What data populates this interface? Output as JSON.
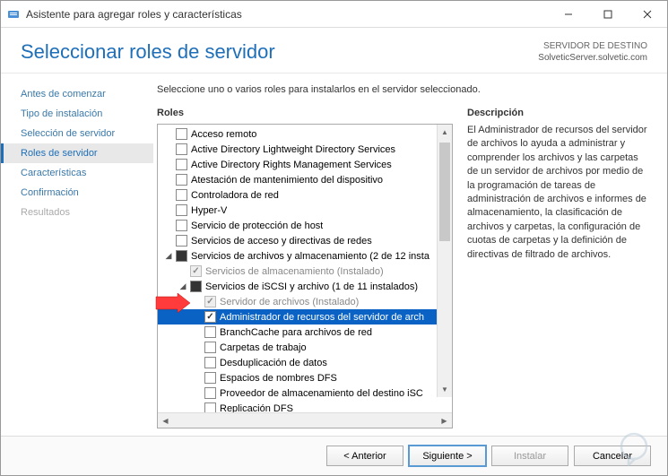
{
  "window": {
    "title": "Asistente para agregar roles y características"
  },
  "header": {
    "page_title": "Seleccionar roles de servidor",
    "dest_label": "SERVIDOR DE DESTINO",
    "dest_value": "SolveticServer.solvetic.com"
  },
  "sidebar": {
    "items": [
      {
        "label": "Antes de comenzar",
        "state": "normal"
      },
      {
        "label": "Tipo de instalación",
        "state": "normal"
      },
      {
        "label": "Selección de servidor",
        "state": "normal"
      },
      {
        "label": "Roles de servidor",
        "state": "active"
      },
      {
        "label": "Características",
        "state": "normal"
      },
      {
        "label": "Confirmación",
        "state": "normal"
      },
      {
        "label": "Resultados",
        "state": "disabled"
      }
    ]
  },
  "main": {
    "instruction": "Seleccione uno o varios roles para instalarlos en el servidor seleccionado.",
    "roles_heading": "Roles",
    "desc_heading": "Descripción",
    "description": "El Administrador de recursos del servidor de archivos lo ayuda a administrar y comprender los archivos y las carpetas de un servidor de archivos por medio de la programación de tareas de administración de archivos e informes de almacenamiento, la clasificación de archivos y carpetas, la configuración de cuotas de carpetas y la definición de directivas de filtrado de archivos.",
    "tree": [
      {
        "indent": 0,
        "expander": "none",
        "cb": "empty",
        "label": "Acceso remoto"
      },
      {
        "indent": 0,
        "expander": "none",
        "cb": "empty",
        "label": "Active Directory Lightweight Directory Services"
      },
      {
        "indent": 0,
        "expander": "none",
        "cb": "empty",
        "label": "Active Directory Rights Management Services"
      },
      {
        "indent": 0,
        "expander": "none",
        "cb": "empty",
        "label": "Atestación de mantenimiento del dispositivo"
      },
      {
        "indent": 0,
        "expander": "none",
        "cb": "empty",
        "label": "Controladora de red"
      },
      {
        "indent": 0,
        "expander": "none",
        "cb": "empty",
        "label": "Hyper-V"
      },
      {
        "indent": 0,
        "expander": "none",
        "cb": "empty",
        "label": "Servicio de protección de host"
      },
      {
        "indent": 0,
        "expander": "none",
        "cb": "empty",
        "label": "Servicios de acceso y directivas de redes"
      },
      {
        "indent": 0,
        "expander": "expanded",
        "cb": "filled",
        "label": "Servicios de archivos y almacenamiento (2 de 12 insta"
      },
      {
        "indent": 1,
        "expander": "none",
        "cb": "disabled-checked",
        "label": "Servicios de almacenamiento (Instalado)",
        "grey": true
      },
      {
        "indent": 1,
        "expander": "expanded",
        "cb": "filled",
        "label": "Servicios de iSCSI y archivo (1 de 11 instalados)"
      },
      {
        "indent": 2,
        "expander": "none",
        "cb": "disabled-checked",
        "label": "Servidor de archivos (Instalado)",
        "grey": true
      },
      {
        "indent": 2,
        "expander": "none",
        "cb": "checked",
        "label": "Administrador de recursos del servidor de arch",
        "selected": true
      },
      {
        "indent": 2,
        "expander": "none",
        "cb": "empty",
        "label": "BranchCache para archivos de red"
      },
      {
        "indent": 2,
        "expander": "none",
        "cb": "empty",
        "label": "Carpetas de trabajo"
      },
      {
        "indent": 2,
        "expander": "none",
        "cb": "empty",
        "label": "Desduplicación de datos"
      },
      {
        "indent": 2,
        "expander": "none",
        "cb": "empty",
        "label": "Espacios de nombres DFS"
      },
      {
        "indent": 2,
        "expander": "none",
        "cb": "empty",
        "label": "Proveedor de almacenamiento del destino iSC"
      },
      {
        "indent": 2,
        "expander": "none",
        "cb": "empty",
        "label": "Replicación DFS"
      }
    ]
  },
  "buttons": {
    "previous": "< Anterior",
    "next": "Siguiente >",
    "install": "Instalar",
    "cancel": "Cancelar"
  }
}
